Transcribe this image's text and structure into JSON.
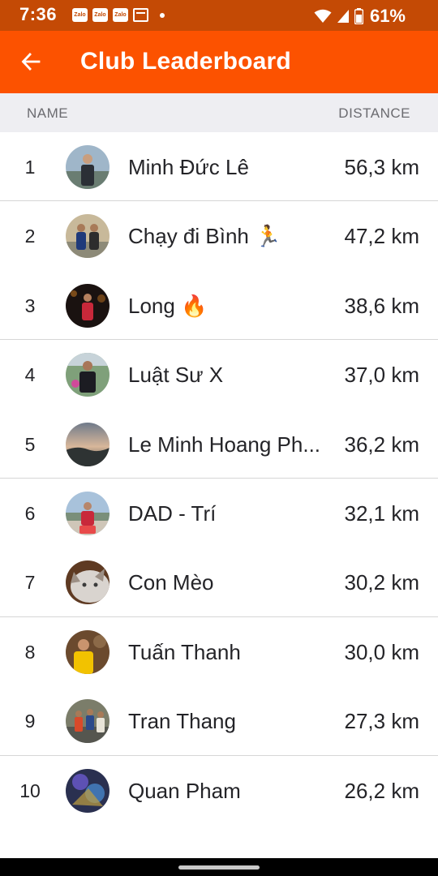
{
  "status_bar": {
    "time": "7:36",
    "notifications": [
      "Zalo",
      "Zalo",
      "Zalo"
    ],
    "battery": "61%",
    "icons": [
      "wifi-icon",
      "signal-icon",
      "battery-icon"
    ]
  },
  "app_bar": {
    "title": "Club Leaderboard",
    "back_icon": "arrow-left-icon",
    "color": "#fc5200"
  },
  "columns": {
    "name": "NAME",
    "distance": "DISTANCE"
  },
  "leaderboard": [
    {
      "rank": "1",
      "name": "Minh Đức Lê",
      "distance": "56,3 km"
    },
    {
      "rank": "2",
      "name": "Chạy đi Bình 🏃",
      "distance": "47,2 km"
    },
    {
      "rank": "3",
      "name": "Long 🔥",
      "distance": "38,6 km"
    },
    {
      "rank": "4",
      "name": "Luật Sư X",
      "distance": "37,0 km"
    },
    {
      "rank": "5",
      "name": "Le Minh Hoang Ph...",
      "distance": "36,2 km"
    },
    {
      "rank": "6",
      "name": "DAD - Trí",
      "distance": "32,1 km"
    },
    {
      "rank": "7",
      "name": "Con Mèo",
      "distance": "30,2 km"
    },
    {
      "rank": "8",
      "name": "Tuấn Thanh",
      "distance": "30,0 km"
    },
    {
      "rank": "9",
      "name": "Tran Thang",
      "distance": "27,3 km"
    },
    {
      "rank": "10",
      "name": "Quan Pham",
      "distance": "26,2 km"
    }
  ]
}
